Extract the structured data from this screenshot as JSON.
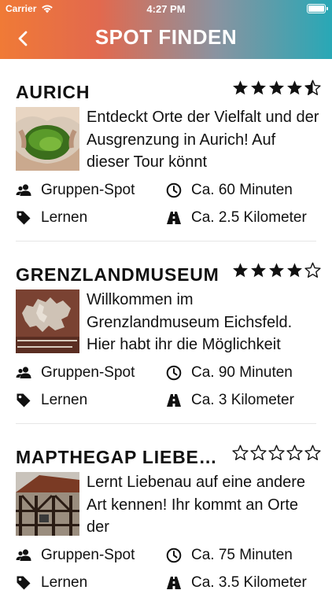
{
  "status_bar": {
    "carrier": "Carrier",
    "time": "4:27 PM"
  },
  "header": {
    "title": "SPOT FINDEN",
    "back_icon": "chevron-left-icon"
  },
  "colors": {
    "header_gradient_start": "#f07a36",
    "header_gradient_end": "#28a8b6",
    "text": "#111111"
  },
  "spots": [
    {
      "name": "AURICH",
      "rating": 4.5,
      "image": "hands-holding-grass-photo",
      "description": "Entdeckt Orte der Vielfalt und der Ausgrenzung in Aurich! Auf dieser Tour könnt",
      "group": "Gruppen-Spot",
      "duration": "Ca. 60 Minuten",
      "category": "Lernen",
      "distance": "Ca. 2.5 Kilometer"
    },
    {
      "name": "GRENZLANDMUSEUM",
      "rating": 4,
      "image": "europe-map-sign-photo",
      "description": "Willkommen im Grenzlandmuseum Eichsfeld. Hier habt ihr die Möglichkeit",
      "group": "Gruppen-Spot",
      "duration": "Ca. 90 Minuten",
      "category": "Lernen",
      "distance": "Ca. 3 Kilometer"
    },
    {
      "name": "MAPTHEGAP LIEBENAU",
      "rating": 0,
      "image": "half-timbered-house-photo",
      "description": "Lernt Liebenau auf eine andere Art kennen! Ihr kommt an Orte der",
      "group": "Gruppen-Spot",
      "duration": "Ca. 75 Minuten",
      "category": "Lernen",
      "distance": "Ca. 3.5 Kilometer"
    }
  ]
}
